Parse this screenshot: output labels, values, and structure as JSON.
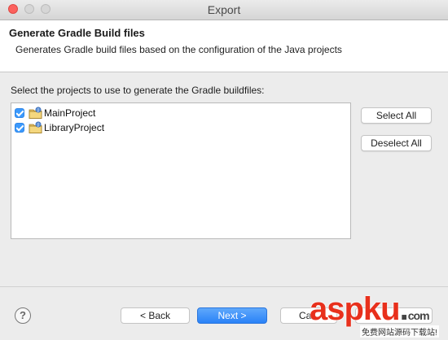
{
  "window": {
    "title": "Export"
  },
  "banner": {
    "title": "Generate Gradle Build files",
    "description": "Generates Gradle build files based on the configuration of the Java projects"
  },
  "instruction": "Select the projects to use to generate the Gradle buildfiles:",
  "projects": [
    {
      "label": "MainProject",
      "checked": true,
      "icon": "java-project-icon"
    },
    {
      "label": "LibraryProject",
      "checked": true,
      "icon": "java-project-icon"
    }
  ],
  "side_buttons": {
    "select_all": "Select All",
    "deselect_all": "Deselect All"
  },
  "footer": {
    "help": "?",
    "back": "< Back",
    "next": "Next >",
    "cancel": "Ca",
    "finish": ""
  },
  "watermark": {
    "main": "aspku",
    "dot": ".",
    "suffix": "com",
    "sub": "免费网站源码下载站!"
  },
  "colors": {
    "accent": "#3b99fc",
    "primary_button": "#2a82f7",
    "watermark": "#e8301c"
  }
}
